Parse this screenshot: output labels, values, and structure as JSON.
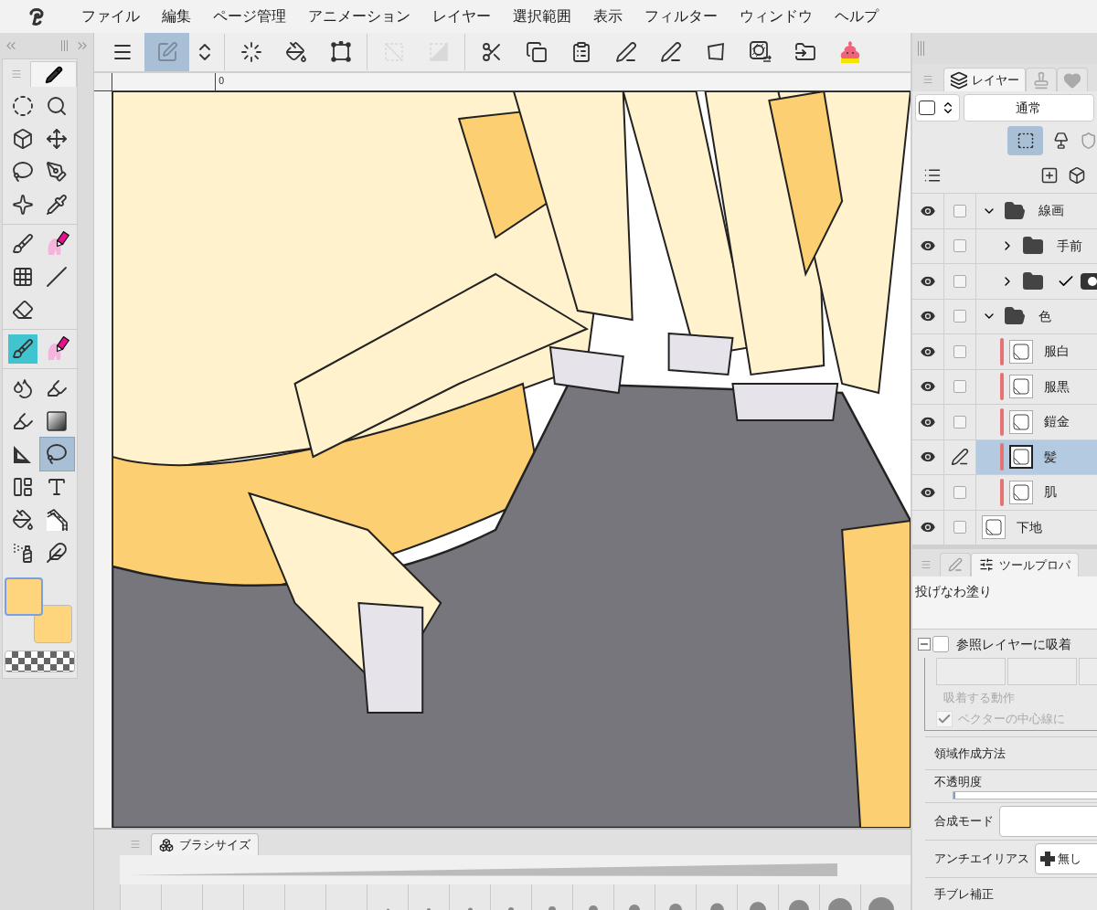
{
  "menu": [
    "ファイル",
    "編集",
    "ページ管理",
    "アニメーション",
    "レイヤー",
    "選択範囲",
    "表示",
    "フィルター",
    "ウィンドウ",
    "ヘルプ"
  ],
  "toolbar": [
    {
      "selected": false,
      "disabled": false
    },
    {
      "selected": true,
      "disabled": false
    },
    {
      "selected": false,
      "disabled": false
    },
    {
      "selected": false,
      "disabled": false
    },
    {
      "selected": false,
      "disabled": false
    },
    {
      "selected": false,
      "disabled": false
    },
    {
      "selected": false,
      "disabled": true
    },
    {
      "selected": false,
      "disabled": true
    },
    {
      "selected": false,
      "disabled": false
    },
    {
      "selected": false,
      "disabled": false
    },
    {
      "selected": false,
      "disabled": false
    },
    {
      "selected": false,
      "disabled": false
    },
    {
      "selected": false,
      "disabled": false
    },
    {
      "selected": false,
      "disabled": false
    },
    {
      "selected": false,
      "disabled": false
    },
    {
      "selected": false,
      "disabled": false
    },
    {
      "selected": false,
      "disabled": false
    }
  ],
  "tools": [
    {
      "selected": false
    },
    {
      "selected": false
    },
    {
      "selected": false
    },
    {
      "selected": false
    },
    {
      "selected": false
    },
    {
      "selected": false
    },
    {
      "selected": false
    },
    {
      "selected": false
    },
    {
      "selected": false
    },
    {
      "selected": false
    },
    {
      "selected": false
    },
    {
      "selected": false
    },
    {
      "selected": false
    },
    {
      "selected": false
    },
    {
      "selected": false
    },
    {
      "selected": false
    },
    {
      "selected": false
    },
    {
      "selected": false
    },
    {
      "selected": false
    },
    {
      "selected": false
    },
    {
      "selected": true
    },
    {
      "selected": false
    },
    {
      "selected": false
    },
    {
      "selected": false
    },
    {
      "selected": false
    },
    {
      "selected": false
    },
    {
      "selected": false
    }
  ],
  "colors": [
    {
      "selected": true,
      "color": "#fed57c"
    },
    {
      "selected": false,
      "color": "#fed57c"
    }
  ],
  "ruler": {
    "origin": "0"
  },
  "layer_panel": {
    "tabs": [
      {
        "label": "レイヤー",
        "selected": true
      },
      {
        "selected": false
      },
      {
        "selected": false
      }
    ],
    "blend_mode": "通常",
    "layers": [
      {
        "kind": "folder",
        "name": "線画",
        "expanded": true,
        "visible": true,
        "selected": false,
        "children": [
          {
            "kind": "folder",
            "name": "手前",
            "expanded": false,
            "visible": true,
            "selected": false
          },
          {
            "kind": "folder",
            "expanded": false,
            "visible": true,
            "selected": false,
            "checked": true
          }
        ]
      },
      {
        "kind": "folder",
        "name": "色",
        "expanded": true,
        "visible": true,
        "selected": false,
        "children": [
          {
            "kind": "raster",
            "name": "服白",
            "visible": true,
            "selected": false,
            "color": "#e57373"
          },
          {
            "kind": "raster",
            "name": "服黒",
            "visible": true,
            "selected": false,
            "color": "#e57373"
          },
          {
            "kind": "raster",
            "name": "鎧金",
            "visible": true,
            "selected": false,
            "color": "#e57373"
          },
          {
            "kind": "raster",
            "name": "髪",
            "visible": true,
            "selected": true,
            "color": "#e57373"
          },
          {
            "kind": "raster",
            "name": "肌",
            "visible": true,
            "selected": false,
            "color": "#e57373"
          }
        ]
      },
      {
        "kind": "raster",
        "name": "下地",
        "visible": true,
        "selected": false
      }
    ]
  },
  "tool_property": {
    "tabs": [
      {
        "selected": false
      },
      {
        "label": "ツールプロパ",
        "selected": true
      }
    ],
    "tool_name": "投げなわ塗り",
    "snap": {
      "label": "参照レイヤーに吸着",
      "checked": false,
      "expanded": true,
      "action_label": "吸着する動作",
      "vector_label": "ベクターの中心線に",
      "vector_checked": true
    },
    "rows": [
      {
        "kind": "label",
        "label": "領域作成方法"
      },
      {
        "kind": "slider",
        "label": "不透明度",
        "level": 0
      },
      {
        "kind": "dropdown",
        "label": "合成モード"
      },
      {
        "kind": "dropdown",
        "label": "アンチエイリアス",
        "value": "無し"
      },
      {
        "kind": "label",
        "label": "手ブレ補正"
      }
    ]
  },
  "brush_size": {
    "tab": "ブラシサイズ"
  }
}
